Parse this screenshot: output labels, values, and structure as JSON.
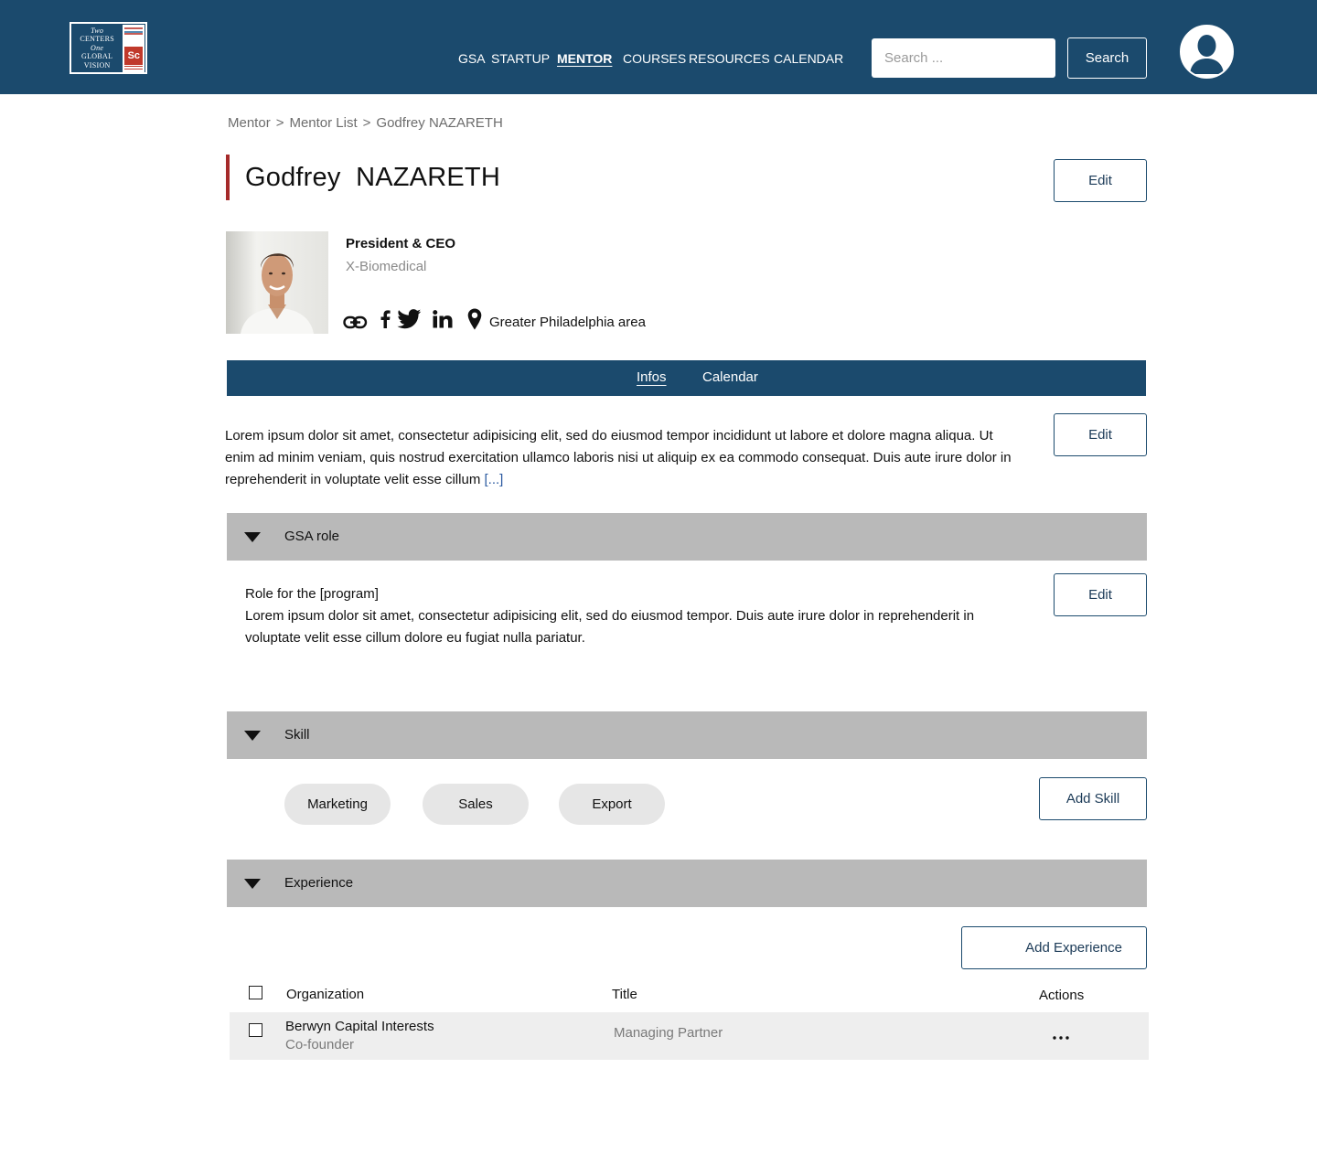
{
  "header": {
    "logo": {
      "line1": "Two",
      "line2": "CENTERS",
      "line3": "One",
      "line4": "GLOBAL",
      "line5": "VISION",
      "badge": "Sc"
    },
    "nav": [
      {
        "label": "GSA",
        "active": false
      },
      {
        "label": "STARTUP",
        "active": false
      },
      {
        "label": "MENTOR",
        "active": true
      },
      {
        "label": "COURSES",
        "active": false
      },
      {
        "label": "RESOURCES",
        "active": false
      },
      {
        "label": "CALENDAR",
        "active": false
      }
    ],
    "search": {
      "placeholder": "Search ...",
      "value": "",
      "button_label": "Search"
    },
    "avatar_icon": "user-avatar-icon"
  },
  "breadcrumb": [
    "Mentor",
    "Mentor List",
    "Godfrey NAZARETH"
  ],
  "breadcrumb_separator": ">",
  "profile": {
    "name": "Godfrey  NAZARETH",
    "edit_label": "Edit",
    "job_title": "President & CEO",
    "company": "X-Biomedical",
    "location": "Greater Philadelphia area",
    "links": [
      "link-icon",
      "facebook-icon",
      "twitter-icon",
      "linkedin-icon",
      "map-pin-icon"
    ]
  },
  "tabs": [
    {
      "label": "Infos",
      "active": true
    },
    {
      "label": "Calendar",
      "active": false
    }
  ],
  "bio": {
    "text": "Lorem ipsum dolor sit amet, consectetur adipisicing elit, sed do eiusmod tempor incididunt ut labore et dolore magna aliqua. Ut enim ad minim veniam, quis nostrud exercitation ullamco laboris nisi ut aliquip ex ea commodo consequat. Duis aute irure dolor in reprehenderit in voluptate velit esse cillum ",
    "more": "[...]",
    "edit_label": "Edit"
  },
  "gsa_role": {
    "heading": "GSA role",
    "line1": "Role for the [program]",
    "text": "Lorem ipsum dolor sit amet, consectetur adipisicing elit, sed do eiusmod tempor. Duis aute irure dolor in reprehenderit in voluptate velit esse cillum dolore eu fugiat nulla pariatur.",
    "edit_label": "Edit"
  },
  "skill": {
    "heading": "Skill",
    "items": [
      "Marketing",
      "Sales",
      "Export"
    ],
    "add_label": "Add Skill"
  },
  "experience": {
    "heading": "Experience",
    "add_label": "Add Experience",
    "columns": [
      "Organization",
      "Title",
      "Actions"
    ],
    "rows": [
      {
        "organization": "Berwyn Capital Interests",
        "role": "Co-founder",
        "title": "Managing Partner",
        "actions": "..."
      }
    ]
  },
  "colors": {
    "primary": "#1b4a6d",
    "accent_bar": "#a52a2a",
    "section_bg": "#b9b9b9",
    "chip_bg": "#e6e6e6",
    "row_bg": "#eeeeee"
  }
}
